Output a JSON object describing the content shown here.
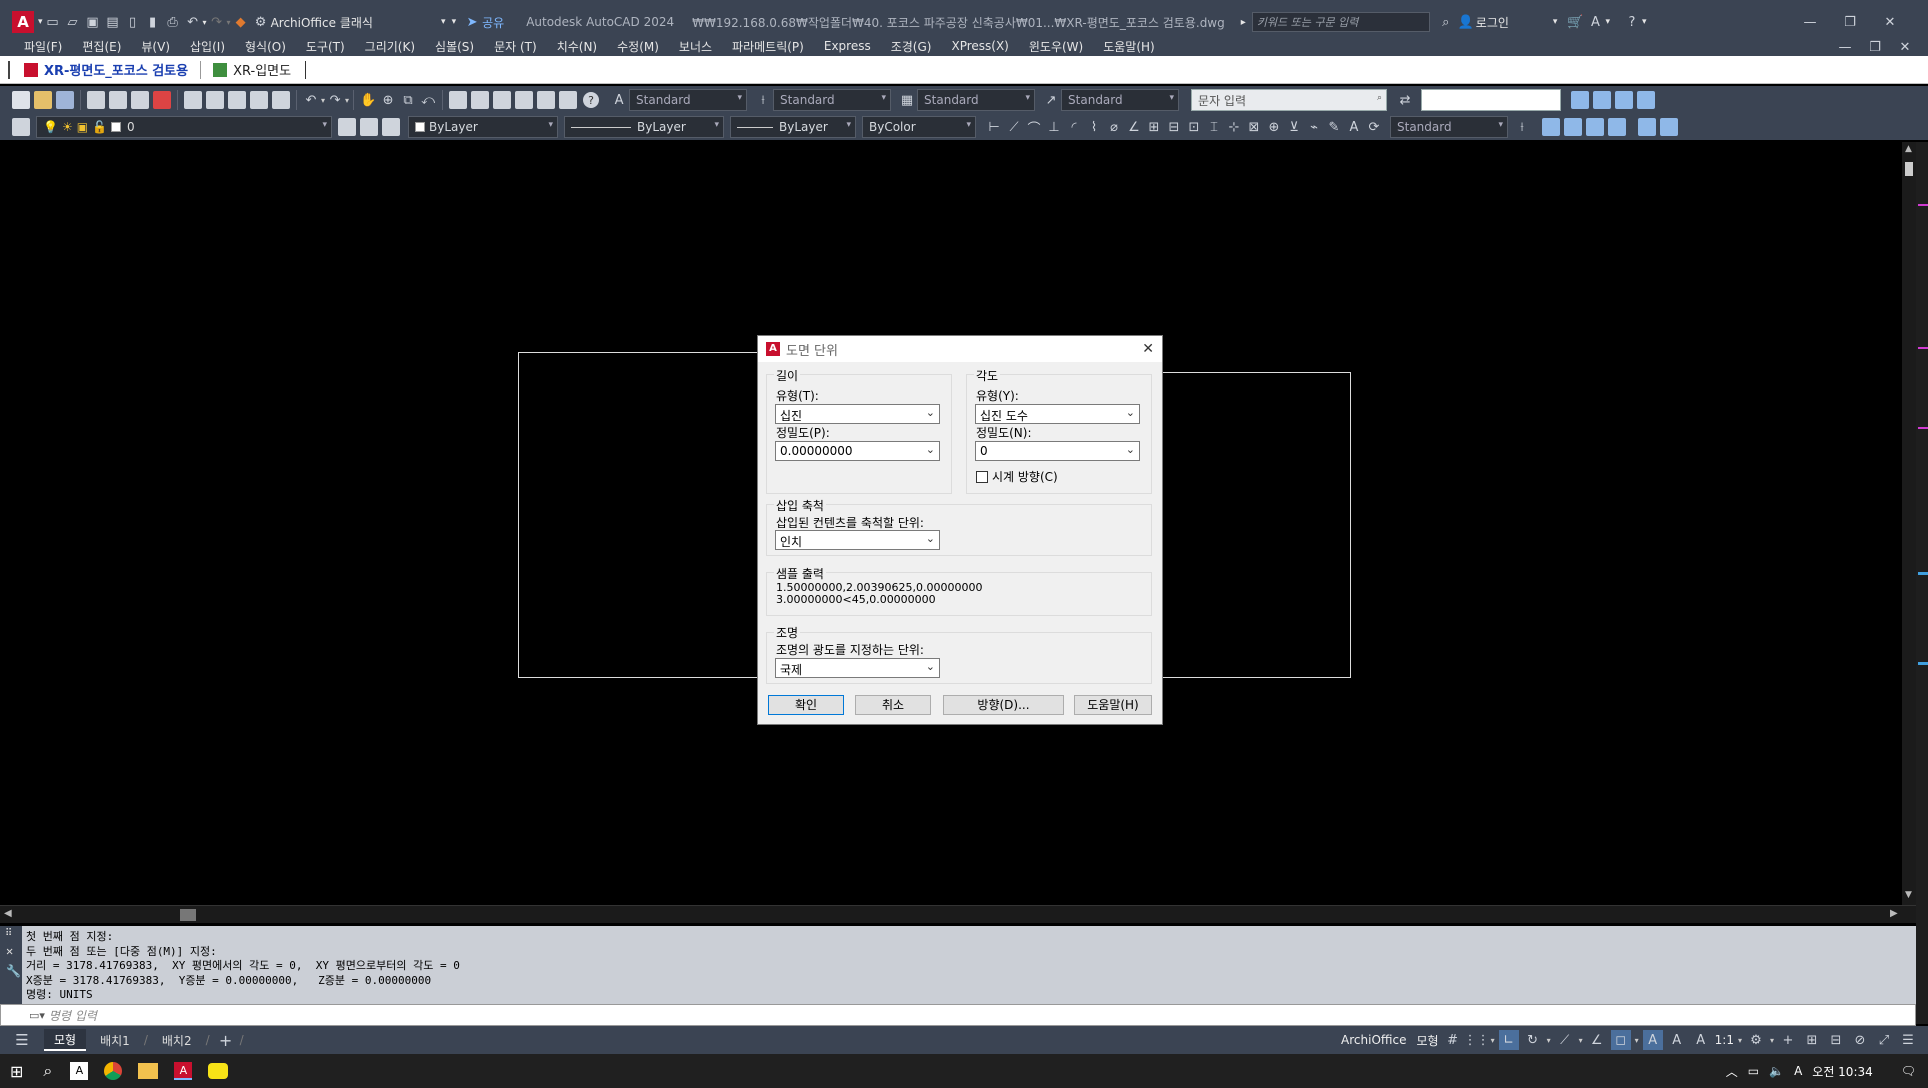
{
  "title_bar": {
    "workspace": "ArchiOffice 클래식",
    "share": "공유",
    "app_title": "Autodesk AutoCAD 2024",
    "file_path": "₩₩192.168.0.68₩작업폴더₩40. 포코스 파주공장 신축공사₩01...₩XR-평면도_포코스 검토용.dwg",
    "search_placeholder": "키워드 또는 구문 입력",
    "login": "로그인"
  },
  "menu": [
    "파일(F)",
    "편집(E)",
    "뷰(V)",
    "삽입(I)",
    "형식(O)",
    "도구(T)",
    "그리기(K)",
    "심볼(S)",
    "문자 (T)",
    "치수(N)",
    "수정(M)",
    "보너스",
    "파라메트릭(P)",
    "Express",
    "조경(G)",
    "XPress(X)",
    "윈도우(W)",
    "도움말(H)"
  ],
  "doc_tabs": [
    "XR-평면도_포코스 검토용",
    "XR-입면도"
  ],
  "toolbar1": {
    "text_style": "Standard",
    "dim_style": "Standard",
    "table_style": "Standard",
    "mleader_style": "Standard",
    "text_input_placeholder": "문자 입력"
  },
  "toolbar2": {
    "layer": "0",
    "color": "ByLayer",
    "linetype": "ByLayer",
    "lineweight": "ByLayer",
    "plotstyle": "ByColor",
    "vp_style": "Standard"
  },
  "dialog": {
    "title": "도면 단위",
    "length": {
      "group": "길이",
      "type_label": "유형(T):",
      "type_value": "십진",
      "precision_label": "정밀도(P):",
      "precision_value": "0.00000000"
    },
    "angle": {
      "group": "각도",
      "type_label": "유형(Y):",
      "type_value": "십진 도수",
      "precision_label": "정밀도(N):",
      "precision_value": "0",
      "clockwise_label": "시계 방향(C)",
      "clockwise_checked": false
    },
    "insert": {
      "group": "삽입 축척",
      "label": "삽입된 컨텐츠를 축척할 단위:",
      "value": "인치"
    },
    "sample": {
      "group": "샘플 출력",
      "line1": "1.50000000,2.00390625,0.00000000",
      "line2": "3.00000000<45,0.00000000"
    },
    "lighting": {
      "group": "조명",
      "label": "조명의 광도를 지정하는 단위:",
      "value": "국제"
    },
    "buttons": {
      "ok": "확인",
      "cancel": "취소",
      "direction": "방향(D)...",
      "help": "도움말(H)"
    }
  },
  "command": {
    "history": [
      "첫 번째 점 지정:",
      "두 번째 점 또는 [다중 점(M)] 지정:",
      "거리 = 3178.41769383,  XY 평면에서의 각도 = 0,  XY 평면으로부터의 각도 = 0",
      "X증분 = 3178.41769383,  Y증분 = 0.00000000,   Z증분 = 0.00000000",
      "명령: UNITS"
    ],
    "prompt_placeholder": "명령 입력"
  },
  "layout_tabs": [
    "모형",
    "배치1",
    "배치2"
  ],
  "status": {
    "archioffice": "ArchiOffice",
    "model": "모형",
    "scale": "1:1"
  },
  "taskbar": {
    "time": "오전 10:34"
  }
}
